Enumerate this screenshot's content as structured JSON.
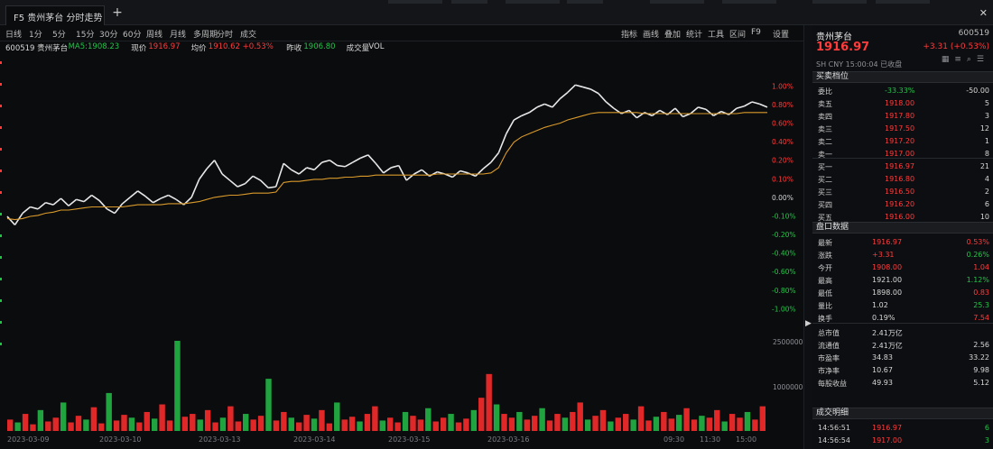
{
  "tab": {
    "title": "F5 贵州茅台 分时走势"
  },
  "toolbar": {
    "left": [
      "日线",
      "1分",
      "5分",
      "15分",
      "30分",
      "60分",
      "周线",
      "月线",
      "多周期",
      "分时",
      "成交"
    ],
    "right": [
      "指标",
      "画线",
      "叠加",
      "统计",
      "工具",
      "区间",
      "F9",
      "设置"
    ]
  },
  "legend": [
    {
      "text": "600519 贵州茅台",
      "color": "#d8d8d8"
    },
    {
      "text": "MA5:1908.23",
      "color": "#25c24a"
    },
    {
      "text": "现价",
      "color": "#d8d8d8"
    },
    {
      "text": "1916.97",
      "color": "#ff3b3b"
    },
    {
      "text": "均价",
      "color": "#d8d8d8"
    },
    {
      "text": "1910.62 +0.53%",
      "color": "#ff3b3b"
    },
    {
      "text": "昨收",
      "color": "#d8d8d8"
    },
    {
      "text": "1906.80",
      "color": "#25c24a"
    },
    {
      "text": "成交量",
      "color": "#d8d8d8"
    },
    {
      "text": "VOL",
      "color": "#d8d8d8"
    }
  ],
  "right_axis": {
    "pct": [
      "1.00%",
      "0.80%",
      "0.60%",
      "0.40%",
      "0.20%",
      "0.10%",
      "0.00%",
      "-0.10%",
      "-0.20%",
      "-0.40%",
      "-0.60%",
      "-0.80%",
      "-1.00%"
    ],
    "vol": [
      "2500000",
      "1000000"
    ]
  },
  "x_ticks": [
    "2023-03-09",
    "2023-03-10",
    "2023-03-13",
    "2023-03-14",
    "2023-03-15",
    "2023-03-16",
    "09:30",
    "11:30",
    "15:00"
  ],
  "panel": {
    "name": "贵州茅台",
    "code": "600519",
    "price": "1916.97",
    "change": "+3.31 (+0.53%)",
    "meta": "SH CNY 15:00:04 已收盘",
    "sec_orderbook": "买卖档位",
    "sell_rows": [
      {
        "label": "委比",
        "value": "-33.33%",
        "extra": "-50.00"
      },
      {
        "label": "卖五",
        "value": "1918.00",
        "extra": "5"
      },
      {
        "label": "卖四",
        "value": "1917.80",
        "extra": "3"
      },
      {
        "label": "卖三",
        "value": "1917.50",
        "extra": "12"
      },
      {
        "label": "卖二",
        "value": "1917.20",
        "extra": "1"
      },
      {
        "label": "卖一",
        "value": "1917.00",
        "extra": "8"
      }
    ],
    "buy_rows": [
      {
        "label": "买一",
        "value": "1916.97",
        "extra": "21"
      },
      {
        "label": "买二",
        "value": "1916.80",
        "extra": "4"
      },
      {
        "label": "买三",
        "value": "1916.50",
        "extra": "2"
      },
      {
        "label": "买四",
        "value": "1916.20",
        "extra": "6"
      },
      {
        "label": "买五",
        "value": "1916.00",
        "extra": "10"
      }
    ],
    "sec_quote": "盘口数据",
    "quote_rows": [
      {
        "l": "最新",
        "m": "1916.97",
        "r": "0.53%"
      },
      {
        "l": "涨跌",
        "m": "+3.31",
        "r": "0.26%"
      },
      {
        "l": "今开",
        "m": "1908.00",
        "r": "1.04"
      },
      {
        "l": "最高",
        "m": "1921.00",
        "r": "1.12%"
      },
      {
        "l": "最低",
        "m": "1898.00",
        "r": "0.83"
      },
      {
        "l": "量比",
        "m": "1.02",
        "r": "25.3"
      },
      {
        "l": "换手",
        "m": "0.19%",
        "r": "7.54"
      }
    ],
    "fin_rows": [
      {
        "l": "总市值",
        "m": "2.41万亿",
        "r": ""
      },
      {
        "l": "流通值",
        "m": "2.41万亿",
        "r": "2.56"
      },
      {
        "l": "市盈率",
        "m": "34.83",
        "r": "33.22"
      },
      {
        "l": "市净率",
        "m": "10.67",
        "r": "9.98"
      },
      {
        "l": "每股收益",
        "m": "49.93",
        "r": "5.12"
      }
    ],
    "sec_trades": "成交明细",
    "trades": [
      {
        "t": "14:56:51",
        "p": "1916.97",
        "v": "6"
      },
      {
        "t": "14:56:54",
        "p": "1917.00",
        "v": "3"
      }
    ]
  },
  "chart_data": {
    "type": "line",
    "series": [
      {
        "values": [
          0.02,
          -0.06,
          0.05,
          0.11,
          0.09,
          0.15,
          0.13,
          0.19,
          0.12,
          0.18,
          0.16,
          0.22,
          0.17,
          0.09,
          0.05,
          0.14,
          0.2,
          0.26,
          0.21,
          0.15,
          0.19,
          0.22,
          0.18,
          0.13,
          0.2,
          0.37,
          0.47,
          0.55,
          0.42,
          0.36,
          0.3,
          0.33,
          0.4,
          0.36,
          0.29,
          0.3,
          0.52,
          0.46,
          0.42,
          0.48,
          0.46,
          0.53,
          0.55,
          0.5,
          0.49,
          0.53,
          0.57,
          0.6,
          0.52,
          0.43,
          0.48,
          0.5,
          0.36,
          0.42,
          0.46,
          0.4,
          0.44,
          0.42,
          0.39,
          0.45,
          0.43,
          0.4,
          0.47,
          0.53,
          0.62,
          0.8,
          0.93,
          0.97,
          1.0,
          1.05,
          1.08,
          1.05,
          1.13,
          1.19,
          1.26,
          1.24,
          1.22,
          1.18,
          1.1,
          1.04,
          0.99,
          1.02,
          0.95,
          1.0,
          0.97,
          1.02,
          0.98,
          1.04,
          0.96,
          0.99,
          1.05,
          1.03,
          0.97,
          1.01,
          0.98,
          1.04,
          1.06,
          1.1,
          1.08,
          1.05
        ]
      },
      {
        "values": [
          0.0,
          -0.01,
          0.0,
          0.02,
          0.03,
          0.05,
          0.06,
          0.08,
          0.08,
          0.09,
          0.1,
          0.11,
          0.11,
          0.11,
          0.11,
          0.11,
          0.12,
          0.13,
          0.13,
          0.13,
          0.13,
          0.14,
          0.14,
          0.14,
          0.15,
          0.16,
          0.18,
          0.2,
          0.21,
          0.22,
          0.22,
          0.23,
          0.24,
          0.24,
          0.24,
          0.25,
          0.34,
          0.35,
          0.35,
          0.36,
          0.37,
          0.37,
          0.38,
          0.38,
          0.39,
          0.39,
          0.4,
          0.4,
          0.41,
          0.41,
          0.41,
          0.41,
          0.41,
          0.41,
          0.41,
          0.41,
          0.42,
          0.42,
          0.42,
          0.42,
          0.42,
          0.42,
          0.42,
          0.43,
          0.48,
          0.62,
          0.72,
          0.77,
          0.8,
          0.83,
          0.86,
          0.88,
          0.9,
          0.93,
          0.95,
          0.97,
          0.99,
          1.0,
          1.0,
          1.0,
          1.0,
          1.0,
          1.0,
          0.99,
          0.99,
          0.99,
          0.99,
          0.99,
          0.99,
          0.99,
          0.99,
          0.99,
          0.99,
          0.99,
          0.99,
          0.99,
          1.0,
          1.0,
          1.0,
          1.0
        ]
      }
    ],
    "ylim": [
      -1.0,
      1.5
    ],
    "volume": [
      12,
      9,
      18,
      7,
      22,
      10,
      14,
      30,
      9,
      16,
      12,
      25,
      8,
      40,
      11,
      17,
      14,
      9,
      20,
      13,
      28,
      11,
      95,
      15,
      18,
      12,
      22,
      9,
      14,
      26,
      10,
      18,
      12,
      16,
      55,
      11,
      20,
      14,
      9,
      17,
      13,
      22,
      8,
      30,
      12,
      15,
      10,
      18,
      26,
      11,
      14,
      9,
      20,
      16,
      12,
      24,
      10,
      14,
      18,
      9,
      13,
      22,
      35,
      60,
      28,
      18,
      14,
      20,
      12,
      16,
      24,
      11,
      18,
      14,
      20,
      30,
      12,
      16,
      22,
      10,
      14,
      18,
      12,
      26,
      11,
      15,
      20,
      13,
      17,
      24,
      12,
      16,
      14,
      22,
      10,
      18,
      14,
      20,
      12,
      26
    ],
    "grid": false
  }
}
